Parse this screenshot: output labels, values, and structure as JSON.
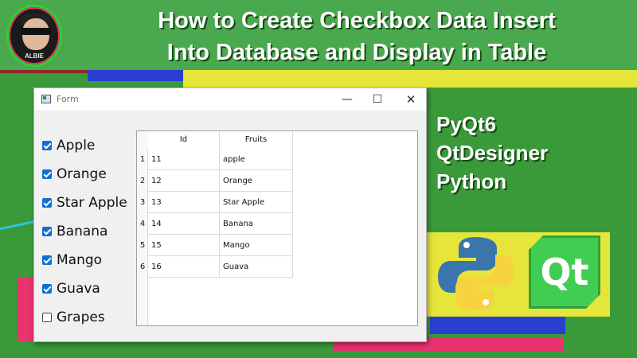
{
  "channel": {
    "avatar_name": "ALBIE"
  },
  "headline": {
    "line1": "How to Create Checkbox Data Insert",
    "line2": "Into Database and Display in Table"
  },
  "tags": [
    "PyQt6",
    "QtDesigner",
    "Python"
  ],
  "logos": {
    "qt_text": "Qt"
  },
  "window": {
    "title": "Form",
    "minimize": "—",
    "maximize": "☐",
    "close": "✕"
  },
  "checkboxes": [
    {
      "label": "Apple",
      "checked": true
    },
    {
      "label": "Orange",
      "checked": true
    },
    {
      "label": "Star Apple",
      "checked": true
    },
    {
      "label": "Banana",
      "checked": true
    },
    {
      "label": "Mango",
      "checked": true
    },
    {
      "label": "Guava",
      "checked": true
    },
    {
      "label": "Grapes",
      "checked": false
    }
  ],
  "table": {
    "headers": {
      "id": "Id",
      "fruit": "Fruits"
    },
    "rows": [
      {
        "num": "1",
        "id": "11",
        "fruit": "apple"
      },
      {
        "num": "2",
        "id": "12",
        "fruit": "Orange"
      },
      {
        "num": "3",
        "id": "13",
        "fruit": "Star Apple"
      },
      {
        "num": "4",
        "id": "14",
        "fruit": "Banana"
      },
      {
        "num": "5",
        "id": "15",
        "fruit": "Mango"
      },
      {
        "num": "6",
        "id": "16",
        "fruit": "Guava"
      }
    ]
  },
  "colors": {
    "accent": "#0f6fd6",
    "background": "#3a9a3a",
    "banner": "#e6e63a",
    "pink": "#e83370",
    "blue": "#2a3fd0"
  }
}
